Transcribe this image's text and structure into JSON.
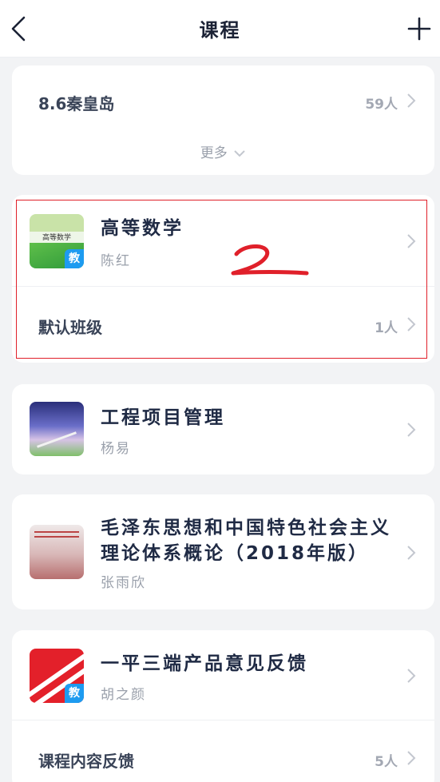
{
  "nav": {
    "title": "课程"
  },
  "card_top": {
    "class_name": "8.6秦皇岛",
    "count": "59人",
    "more_label": "更多"
  },
  "courses": [
    {
      "title": "高等数学",
      "teacher": "陈红",
      "badge": "教",
      "class_row": {
        "name": "默认班级",
        "count": "1人"
      }
    },
    {
      "title": "工程项目管理",
      "teacher": "杨易"
    },
    {
      "title": "毛泽东思想和中国特色社会主义理论体系概论（2018年版）",
      "teacher": "张雨欣"
    },
    {
      "title": "一平三端产品意见反馈",
      "teacher": "胡之颜",
      "badge": "教",
      "class_row": {
        "name": "课程内容反馈",
        "count": "5人"
      }
    }
  ],
  "annotation": {
    "label": "2",
    "color": "#e0202a"
  },
  "colors": {
    "accent": "#1d9bf0",
    "highlight": "#e0202a"
  }
}
